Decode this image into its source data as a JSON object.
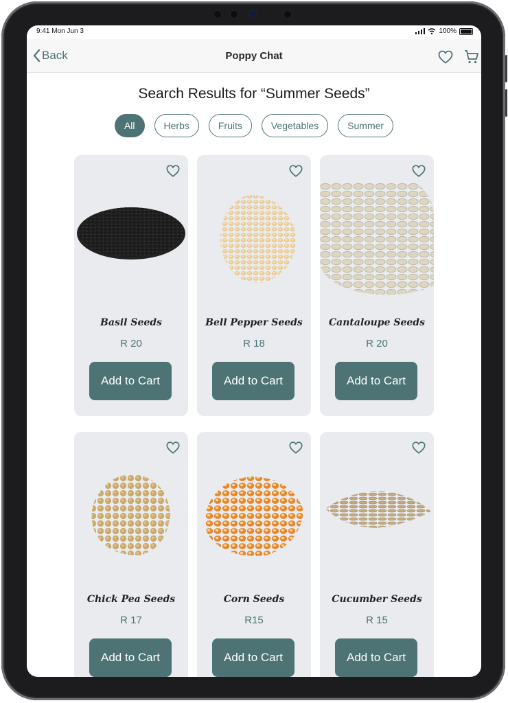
{
  "status": {
    "time": "9:41  Mon Jun 3",
    "battery": "100%"
  },
  "nav": {
    "back_label": "Back",
    "title": "Poppy Chat"
  },
  "heading": "Search Results for “Summer Seeds”",
  "filters": [
    {
      "label": "All",
      "active": true
    },
    {
      "label": "Herbs",
      "active": false
    },
    {
      "label": "Fruits",
      "active": false
    },
    {
      "label": "Vegetables",
      "active": false
    },
    {
      "label": "Summer",
      "active": false
    }
  ],
  "products": [
    {
      "name": "Basil Seeds",
      "price": "R 20",
      "button": "Add to Cart"
    },
    {
      "name": "Bell Pepper Seeds",
      "price": "R 18",
      "button": "Add to Cart"
    },
    {
      "name": "Cantaloupe Seeds",
      "price": "R 20",
      "button": "Add to Cart"
    },
    {
      "name": "Chick Pea Seeds",
      "price": "R 17",
      "button": "Add to Cart"
    },
    {
      "name": "Corn Seeds",
      "price": "R15",
      "button": "Add to Cart"
    },
    {
      "name": "Cucumber Seeds",
      "price": "R 15",
      "button": "Add to Cart"
    }
  ],
  "colors": {
    "accent": "#4d7375",
    "card_bg": "#e9ebee"
  },
  "icons": {
    "back": "chevron-left-icon",
    "favorite": "heart-icon",
    "cart": "cart-icon"
  }
}
